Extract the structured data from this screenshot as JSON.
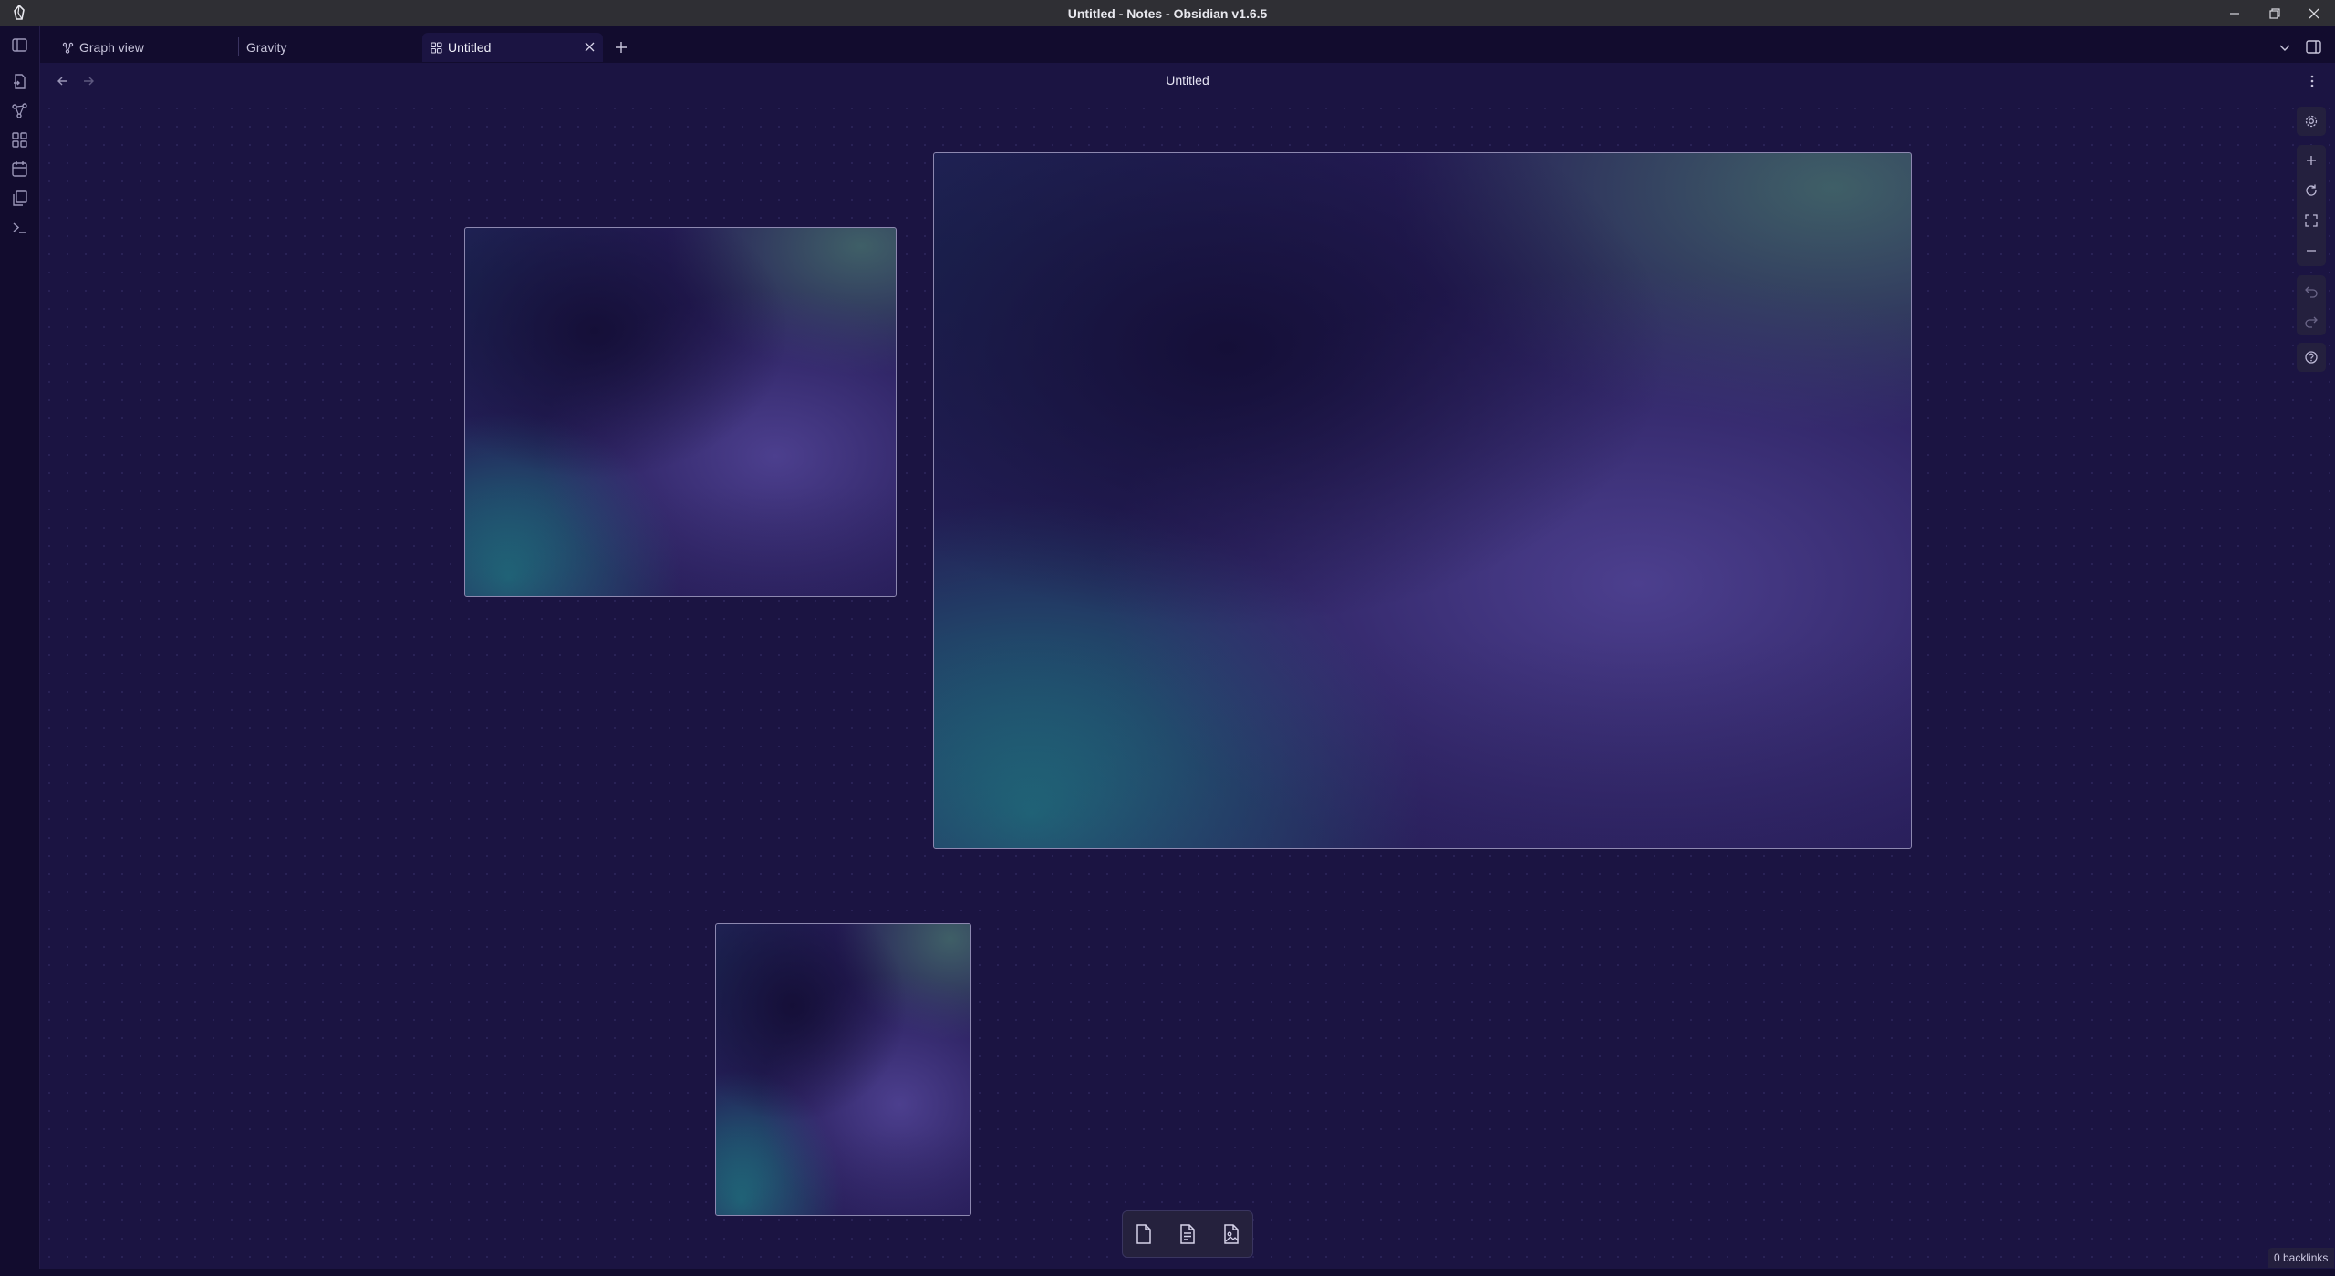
{
  "window": {
    "title": "Untitled - Notes - Obsidian v1.6.5",
    "controls": [
      "minimize-icon",
      "restore-icon",
      "close-icon"
    ]
  },
  "tabs": [
    {
      "label": "Graph view",
      "icon": "graph-icon",
      "active": false
    },
    {
      "label": "Gravity",
      "icon": "",
      "active": false
    },
    {
      "label": "Untitled",
      "icon": "canvas-icon",
      "active": true
    }
  ],
  "view": {
    "title": "Untitled"
  },
  "ribbon": {
    "items": [
      "sidebar-toggle-icon",
      "file-switcher-icon",
      "graph-icon",
      "canvas-icon",
      "calendar-icon",
      "templates-icon",
      "terminal-icon"
    ]
  },
  "canvas_controls": [
    "settings-icon",
    "zoom-in-icon",
    "reset-zoom-icon",
    "fit-icon",
    "zoom-out-icon",
    "undo-icon",
    "redo-icon",
    "help-icon"
  ],
  "bottom_toolbar": [
    "add-card-icon",
    "add-note-icon",
    "add-media-icon"
  ],
  "status": {
    "backlinks": "0 backlinks"
  },
  "colors": {
    "canvas_bg": "#1b1442",
    "chrome_bg": "#120c2e",
    "titlebar_bg": "#2f2f34",
    "card_border": "#8d88b0"
  }
}
